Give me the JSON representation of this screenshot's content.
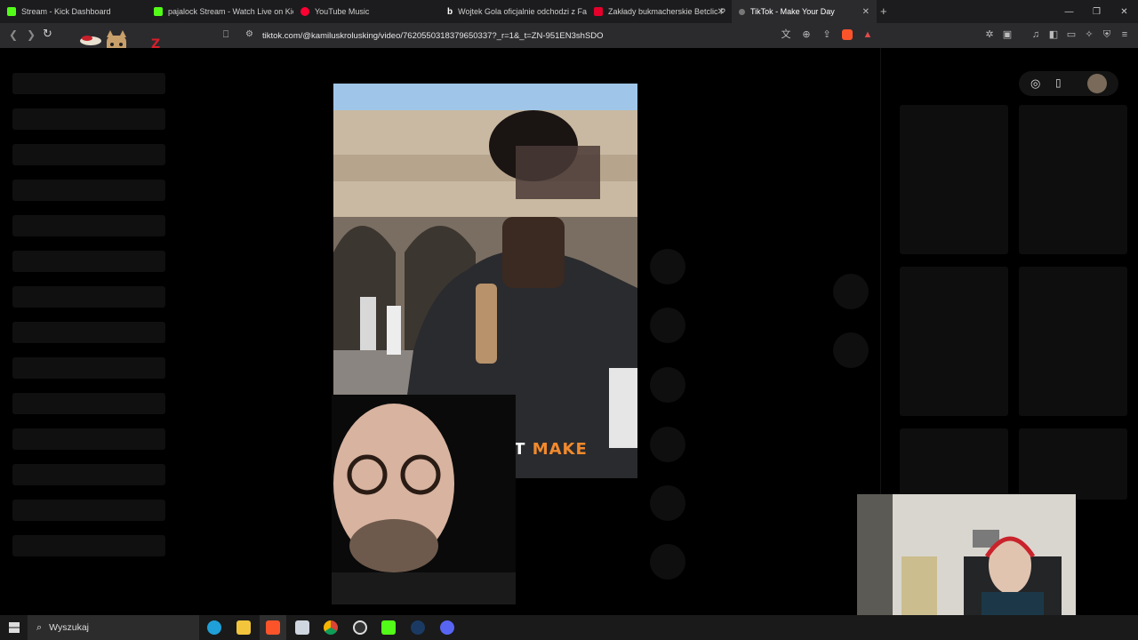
{
  "browser": {
    "tabs": [
      {
        "title": "Stream - Kick Dashboard",
        "favicon": "kick-icon",
        "color": "#53fc18",
        "active": false
      },
      {
        "title": "pajalock Stream - Watch Live on Kick",
        "favicon": "kick-icon",
        "color": "#53fc18",
        "active": false
      },
      {
        "title": "YouTube Music",
        "favicon": "youtube-music-icon",
        "color": "#ff0033",
        "active": false
      },
      {
        "title": "Wojtek Gola oficjalnie odchodzi z Fa",
        "favicon": "b-icon",
        "color": "#ffffff",
        "active": false
      },
      {
        "title": "Zakłady bukmacherskie Betclic P",
        "favicon": "betclic-icon",
        "color": "#e4002b",
        "active": false
      },
      {
        "title": "TikTok - Make Your Day",
        "favicon": "tiktok-icon",
        "color": "#888888",
        "active": true
      }
    ],
    "new_tab": "+",
    "address": "tiktok.com/@kamiluskrolusking/video/7620550318379650337?_r=1&_t=ZN-951EN3shSDO"
  },
  "page": {
    "caption_part1": "N DON'T ",
    "caption_part2": "MAKE",
    "caption_highlight_color": "#f28a2d"
  },
  "taskbar": {
    "search_placeholder": "Wyszukaj",
    "apps": [
      "edge-icon",
      "file-explorer-icon",
      "brave-icon",
      "notepad-icon",
      "chrome-icon",
      "obs-icon",
      "kick-icon",
      "steam-icon",
      "discord-icon"
    ]
  }
}
